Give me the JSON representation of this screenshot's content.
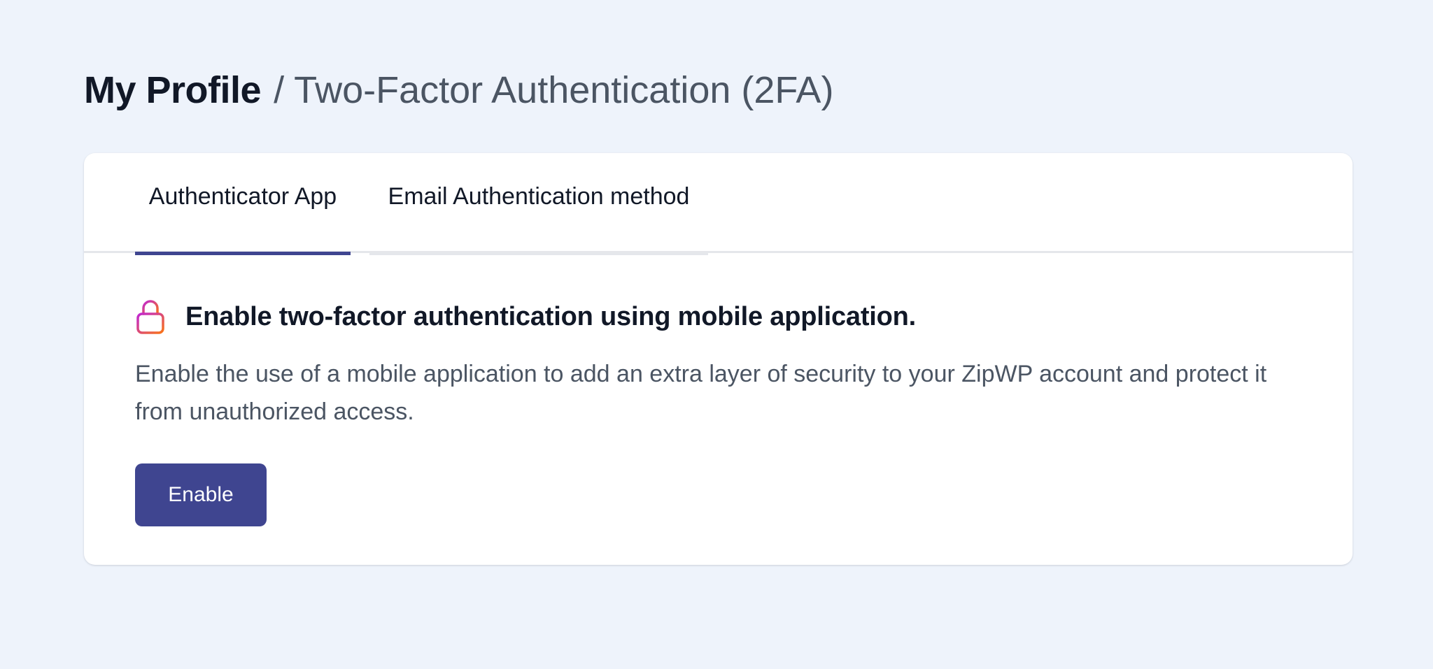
{
  "breadcrumb": {
    "root": "My Profile",
    "separator": "/",
    "current": "Two-Factor Authentication (2FA)"
  },
  "tabs": [
    {
      "label": "Authenticator App",
      "active": true
    },
    {
      "label": "Email Authentication method",
      "active": false
    }
  ],
  "section": {
    "icon": "lock-icon",
    "heading": "Enable two-factor authentication using mobile application.",
    "description": "Enable the use of a mobile application to add an extra layer of security to your ZipWP account and protect it from unauthorized access.",
    "button_label": "Enable"
  },
  "colors": {
    "page_background": "#eef3fb",
    "accent": "#3f4590",
    "lock_gradient_start": "#c026d3",
    "lock_gradient_end": "#f97316"
  }
}
